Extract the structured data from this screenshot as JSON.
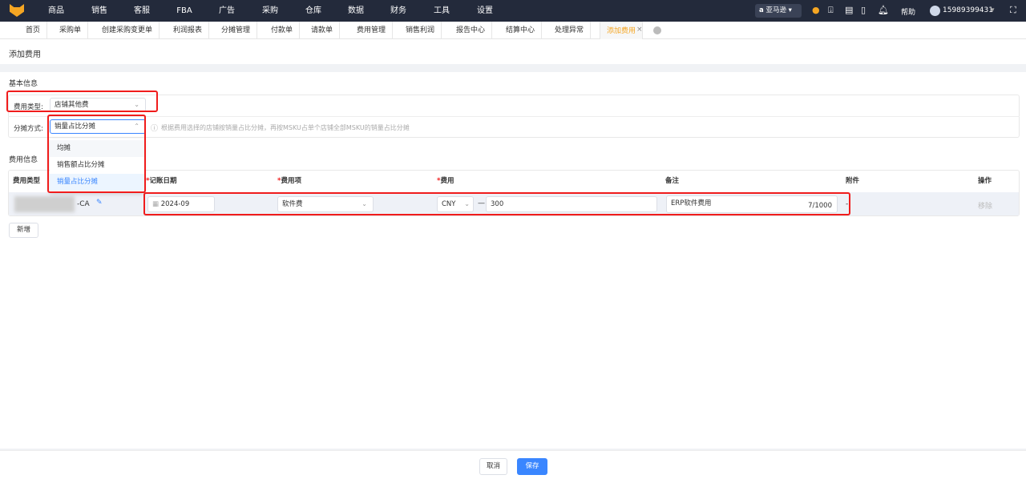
{
  "topnav": {
    "menu": [
      "商品",
      "销售",
      "客服",
      "FBA",
      "广告",
      "采购",
      "仓库",
      "数据",
      "财务",
      "工具",
      "设置"
    ],
    "marketplace": "亚马逊",
    "help": "帮助",
    "user": "15989399431"
  },
  "tabs": [
    "首页",
    "采购单",
    "创建采购变更单",
    "利润报表",
    "分摊管理",
    "付款单",
    "请款单",
    "费用管理",
    "销售利润",
    "报告中心",
    "结算中心",
    "处理异常",
    "添加费用"
  ],
  "page_title": "添加费用",
  "basic": {
    "section": "基本信息",
    "fee_type_label": "费用类型:",
    "fee_type_value": "店铺其他费",
    "alloc_label": "分摊方式:",
    "alloc_value": "销量占比分摊",
    "hint": "根据费用选择的店铺按销量占比分摊，再按MSKU占单个店铺全部MSKU的销量占比分摊",
    "options": [
      "均摊",
      "销售额占比分摊",
      "销量占比分摊"
    ]
  },
  "fee": {
    "section": "费用信息",
    "headers": [
      "费用类型",
      "记账日期",
      "费用项",
      "费用",
      "备注",
      "附件",
      "操作"
    ],
    "required_mark": "*",
    "row": {
      "type_suffix": "-CA",
      "date": "2024-09",
      "item": "软件费",
      "currency": "CNY",
      "amount": "300",
      "remark": "ERP软件费用",
      "counter": "7/1000",
      "attachment": "-",
      "remove": "移除"
    },
    "add": "新增"
  },
  "footer": {
    "cancel": "取消",
    "save": "保存"
  },
  "colors": {
    "accent": "#3a86ff",
    "active_tab": "#f5a623",
    "highlight": "#f01c1c"
  }
}
